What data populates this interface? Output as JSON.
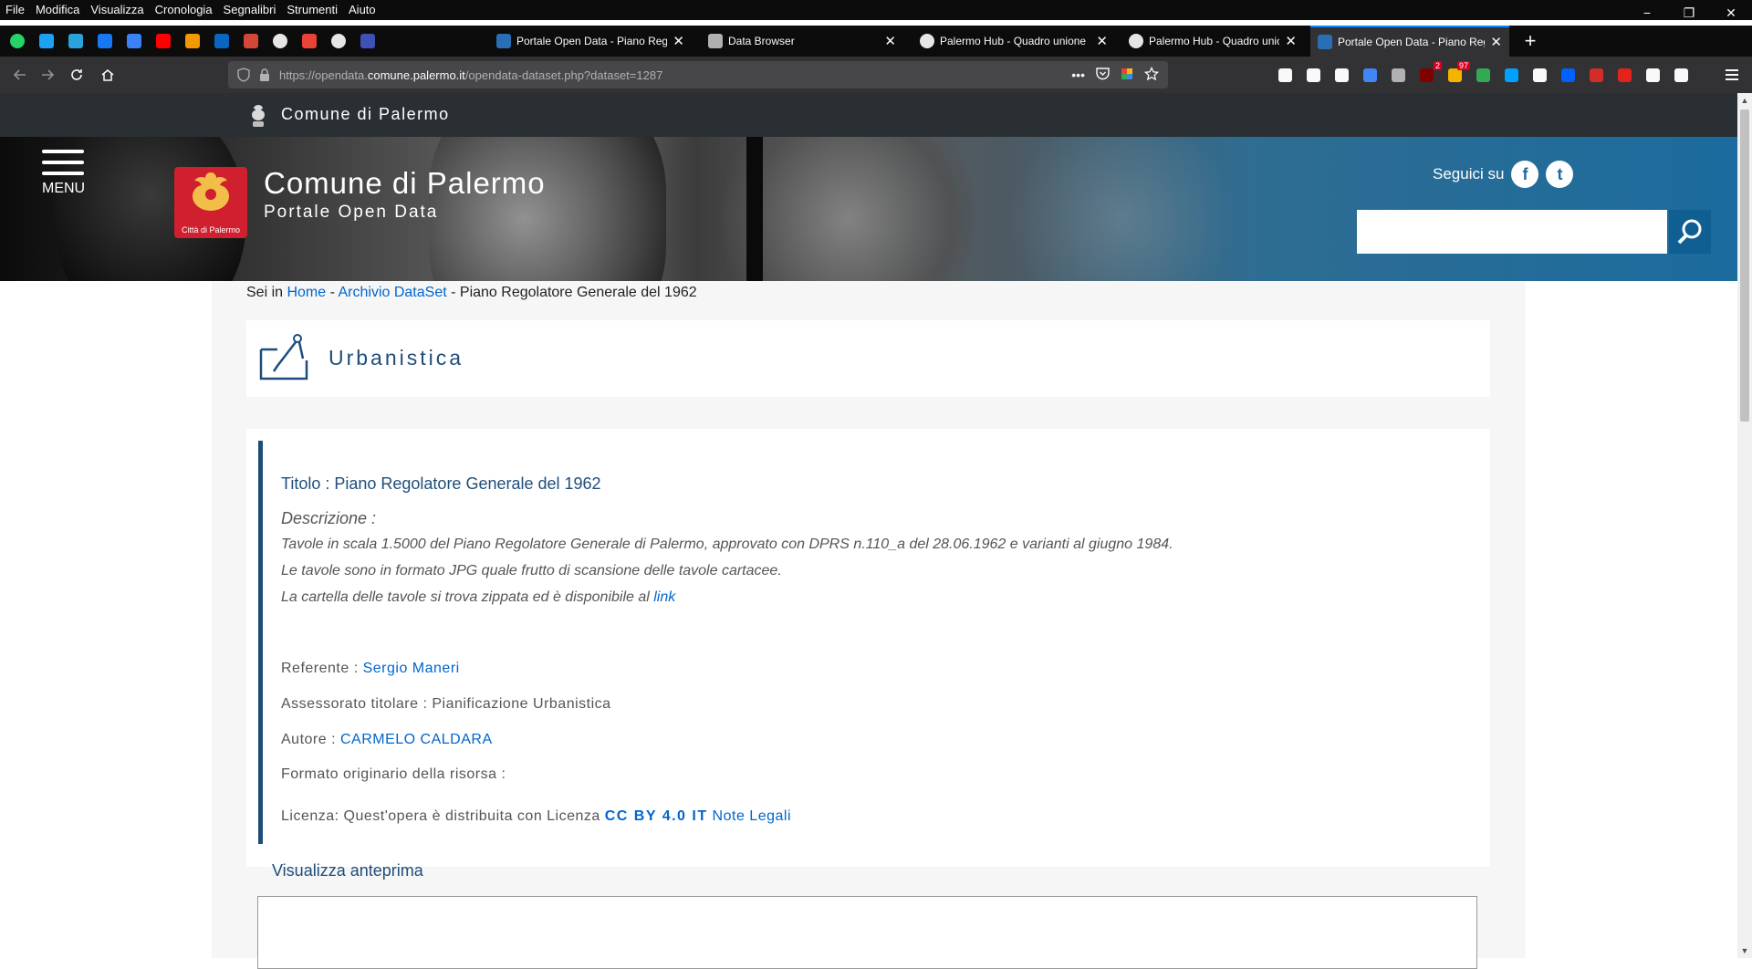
{
  "menubar": [
    "File",
    "Modifica",
    "Visualizza",
    "Cronologia",
    "Segnalibri",
    "Strumenti",
    "Aiuto"
  ],
  "window_controls": [
    "−",
    "❐",
    "✕"
  ],
  "pinned_tabs": [
    {
      "icon": "whatsapp-icon",
      "color": "#25d366"
    },
    {
      "icon": "twitter-icon",
      "color": "#1da1f2"
    },
    {
      "icon": "telegram-icon",
      "color": "#2aa3dc"
    },
    {
      "icon": "facebook-icon",
      "color": "#1877f2"
    },
    {
      "icon": "messenger-icon",
      "color": "#3b82f6"
    },
    {
      "icon": "youtube-icon",
      "color": "#ff0000"
    },
    {
      "icon": "analytics-icon",
      "color": "#f29900"
    },
    {
      "icon": "linkedin-icon",
      "color": "#0a66c2"
    },
    {
      "icon": "gmail-icon",
      "color": "#d44638"
    },
    {
      "icon": "github-icon",
      "color": "#e6e6e6"
    },
    {
      "icon": "gmail-icon",
      "color": "#ea4335"
    },
    {
      "icon": "openai-icon",
      "color": "#e6e6e6"
    },
    {
      "icon": "chart-icon",
      "color": "#3f51b5"
    }
  ],
  "tabs": [
    {
      "label": "Portale Open Data - Piano Rego",
      "icon": "open-data-icon",
      "active": false
    },
    {
      "label": "Data Browser",
      "icon": "data-browser-icon",
      "active": false
    },
    {
      "label": "Palermo Hub - Quadro unione",
      "icon": "github-icon",
      "active": false
    },
    {
      "label": "Palermo Hub - Quadro unione",
      "icon": "github-icon",
      "active": false
    },
    {
      "label": "Portale Open Data - Piano Rego",
      "icon": "open-data-icon",
      "active": true
    }
  ],
  "new_tab": "+",
  "address": {
    "prefix": "https://opendata.",
    "domain": "comune.palermo.it",
    "path": "/opendata-dataset.php?dataset=1287"
  },
  "toolbar_icons": [
    {
      "icon": "reader-icon",
      "color": "#f9f9fa",
      "badge": ""
    },
    {
      "icon": "library-icon",
      "color": "#f9f9fa",
      "badge": ""
    },
    {
      "icon": "sidebar-icon",
      "color": "#f9f9fa",
      "badge": ""
    },
    {
      "icon": "google-icon",
      "color": "#4285f4",
      "badge": ""
    },
    {
      "icon": "crop-icon",
      "color": "#b1b1b3",
      "badge": ""
    },
    {
      "icon": "ublock-icon",
      "color": "#800000",
      "badge": "2"
    },
    {
      "icon": "mail-icon",
      "color": "#f5b400",
      "badge": "97"
    },
    {
      "icon": "extension-icon",
      "color": "#34a853",
      "badge": ""
    },
    {
      "icon": "refresh-ext-icon",
      "color": "#00a1ff",
      "badge": ""
    },
    {
      "icon": "chat-icon",
      "color": "#f9f9fa",
      "badge": ""
    },
    {
      "icon": "dropbox-icon",
      "color": "#0061ff",
      "badge": ""
    },
    {
      "icon": "lastpass-icon",
      "color": "#d32d27",
      "badge": ""
    },
    {
      "icon": "pdf-icon",
      "color": "#e2231a",
      "badge": ""
    },
    {
      "icon": "feather-icon",
      "color": "#f9f9fa",
      "badge": ""
    },
    {
      "icon": "screenshot-icon",
      "color": "#f9f9fa",
      "badge": ""
    }
  ],
  "site": {
    "strip_title": "Comune di Palermo",
    "menu_label": "MENU",
    "logo_text": "Città di Palermo",
    "title": "Comune di Palermo",
    "subtitle": "Portale Open Data",
    "follow_label": "Seguici su",
    "facebook_glyph": "f",
    "twitter_glyph": "t"
  },
  "breadcrumb": {
    "prefix": "Sei in ",
    "home": "Home",
    "sep": " - ",
    "archive": "Archivio DataSet",
    "current": "Piano Regolatore Generale del 1962"
  },
  "category": {
    "title": "Urbanistica"
  },
  "dataset": {
    "titolo": "Titolo : Piano Regolatore Generale del 1962",
    "descrizione_label": "Descrizione :",
    "desc_line1": "Tavole in scala 1.5000 del Piano Regolatore Generale di Palermo, approvato con DPRS n.110_a del 28.06.1962 e varianti al giugno 1984.",
    "desc_line2": "Le tavole sono in formato JPG quale frutto di scansione delle tavole cartacee.",
    "desc_line3_text": "La cartella delle tavole si trova zippata ed è disponibile al ",
    "desc_line3_link": "link",
    "referente_label": "Referente : ",
    "referente": "Sergio Maneri",
    "assessorato": "Assessorato titolare : Pianificazione Urbanistica",
    "autore_label": "Autore : ",
    "autore": "CARMELO CALDARA",
    "formato": "Formato originario della risorsa :",
    "licenza_label": "Licenza: Quest'opera è distribuita con Licenza ",
    "licenza_cc": "CC BY 4.0 IT",
    "note_legali": "Note Legali"
  },
  "preview": {
    "heading": "Visualizza anteprima"
  }
}
